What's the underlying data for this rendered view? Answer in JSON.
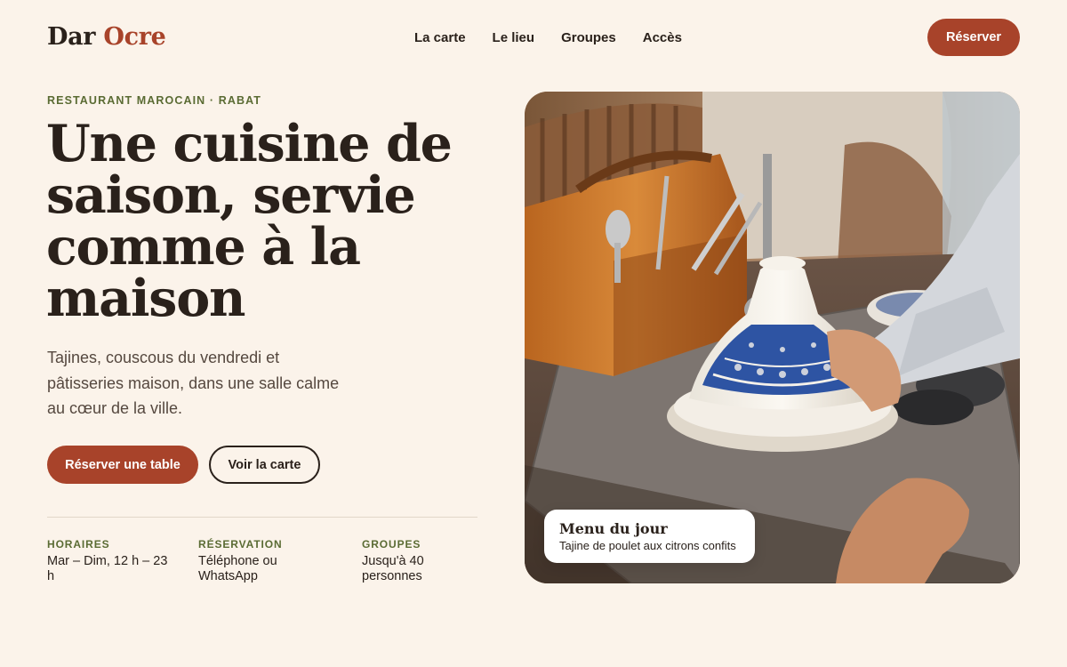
{
  "header": {
    "logo_part1": "Dar",
    "logo_part2": "Ocre",
    "nav": [
      "La carte",
      "Le lieu",
      "Groupes",
      "Accès"
    ],
    "cta_label": "Réserver"
  },
  "hero": {
    "eyebrow": "RESTAURANT MAROCAIN · RABAT",
    "headline": "Une cuisine de saison, servie comme à la maison",
    "subtext": "Tajines, couscous du vendredi et pâtisseries maison, dans une salle calme au cœur de la ville.",
    "primary_button": "Réserver une table",
    "secondary_button": "Voir la carte"
  },
  "info": [
    {
      "label": "HORAIRES",
      "value": "Mar – Dim, 12 h – 23 h"
    },
    {
      "label": "RÉSERVATION",
      "value": "Téléphone ou WhatsApp"
    },
    {
      "label": "GROUPES",
      "value": "Jusqu'à 40 personnes"
    }
  ],
  "menu_card": {
    "title": "Menu du jour",
    "dish": "Tajine de poulet aux citrons confits"
  },
  "colors": {
    "background": "#fbf3ea",
    "accent": "#a8432a",
    "eyebrow_green": "#5a6b33",
    "text_dark": "#2a211b"
  },
  "icons": {
    "hero_image": "tajine-photo"
  }
}
